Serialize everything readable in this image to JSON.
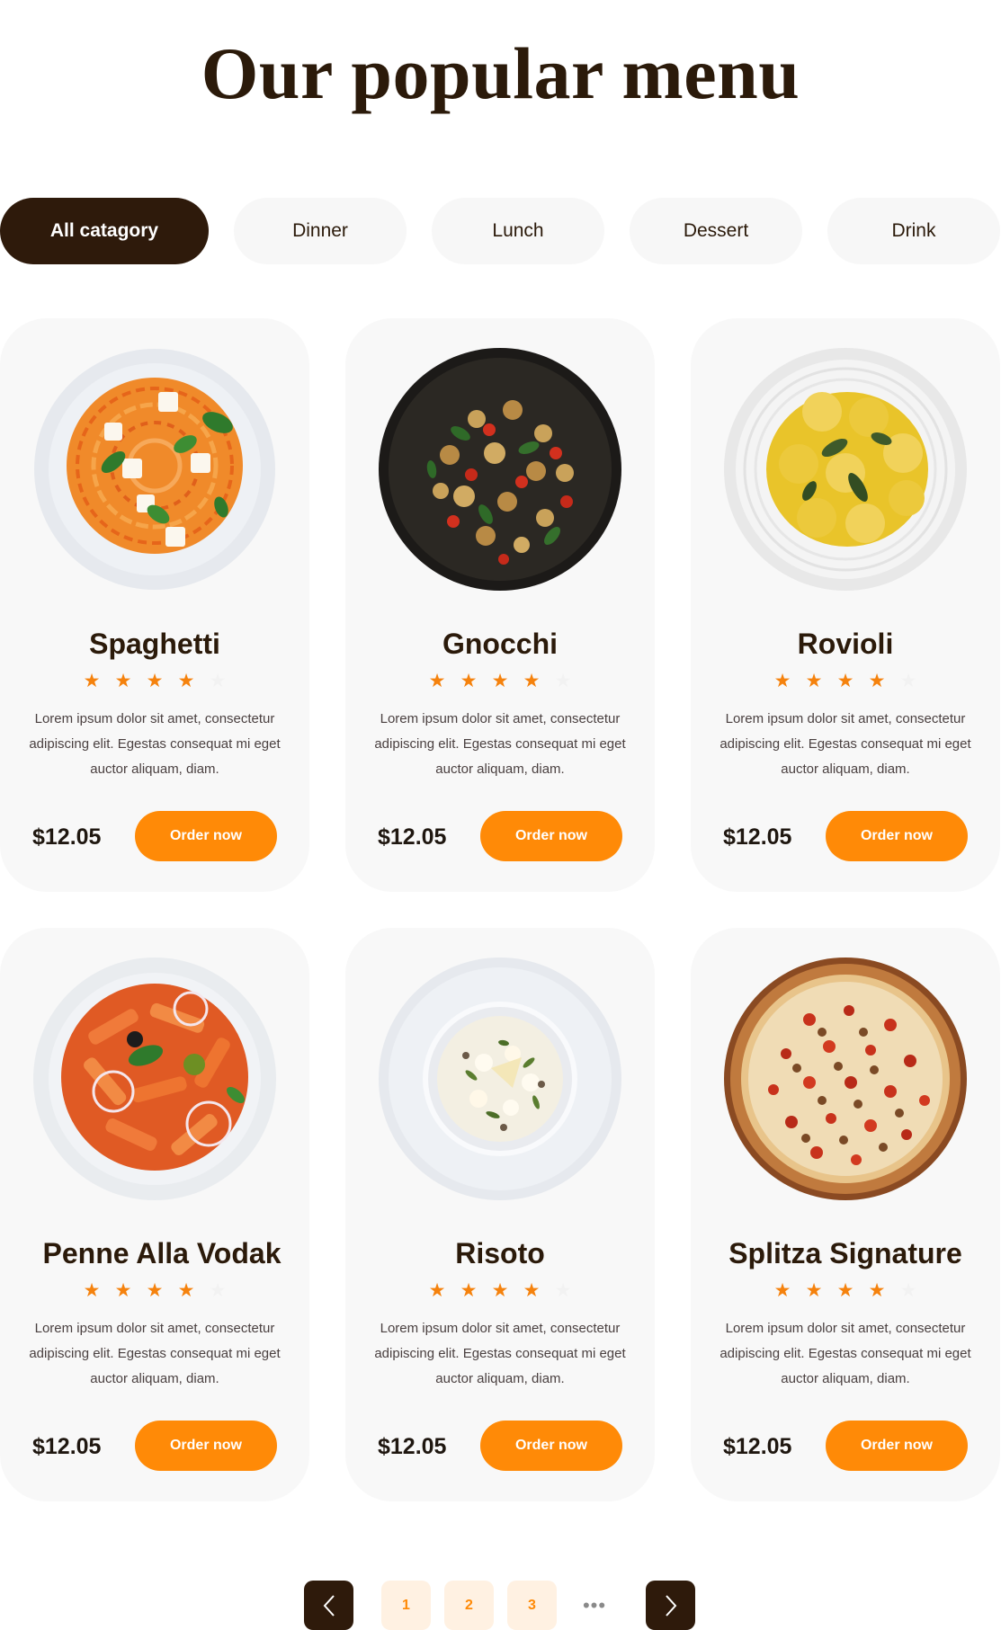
{
  "page": {
    "title": "Our popular menu"
  },
  "categories": [
    {
      "label": "All catagory",
      "active": true
    },
    {
      "label": "Dinner",
      "active": false
    },
    {
      "label": "Lunch",
      "active": false
    },
    {
      "label": "Dessert",
      "active": false
    },
    {
      "label": "Drink",
      "active": false
    }
  ],
  "menu_items": [
    {
      "name": "Spaghetti",
      "rating": 4,
      "max_rating": 5,
      "description": "Lorem ipsum dolor sit amet, consectetur adipiscing elit. Egestas consequat mi eget auctor aliquam, diam.",
      "price": "$12.05",
      "order_label": "Order now",
      "image": "spaghetti-plate-image"
    },
    {
      "name": "Gnocchi",
      "rating": 4,
      "max_rating": 5,
      "description": "Lorem ipsum dolor sit amet, consectetur adipiscing elit. Egestas consequat mi eget auctor aliquam, diam.",
      "price": "$12.05",
      "order_label": "Order now",
      "image": "gnocchi-pan-image"
    },
    {
      "name": "Rovioli",
      "rating": 4,
      "max_rating": 5,
      "description": "Lorem ipsum dolor sit amet, consectetur adipiscing elit. Egestas consequat mi eget auctor aliquam, diam.",
      "price": "$12.05",
      "order_label": "Order now",
      "image": "ravioli-plate-image"
    },
    {
      "name": "Penne Alla Vodak",
      "rating": 4,
      "max_rating": 5,
      "description": "Lorem ipsum dolor sit amet, consectetur adipiscing elit. Egestas consequat mi eget auctor aliquam, diam.",
      "price": "$12.05",
      "order_label": "Order now",
      "image": "penne-plate-image"
    },
    {
      "name": "Risoto",
      "rating": 4,
      "max_rating": 5,
      "description": "Lorem ipsum dolor sit amet, consectetur adipiscing elit. Egestas consequat mi eget auctor aliquam, diam.",
      "price": "$12.05",
      "order_label": "Order now",
      "image": "risotto-bowl-image"
    },
    {
      "name": "Splitza Signature",
      "rating": 4,
      "max_rating": 5,
      "description": "Lorem ipsum dolor sit amet, consectetur adipiscing elit. Egestas consequat mi eget auctor aliquam, diam.",
      "price": "$12.05",
      "order_label": "Order now",
      "image": "pizza-image"
    }
  ],
  "pagination": {
    "prev_icon": "chevron-left-icon",
    "next_icon": "chevron-right-icon",
    "pages": [
      "1",
      "2",
      "3"
    ],
    "ellipsis": "•••"
  },
  "colors": {
    "brand_dark": "#2e1a0b",
    "accent_orange": "#ff8a07",
    "card_bg": "#f8f8f8",
    "star_on": "#f5820d"
  }
}
